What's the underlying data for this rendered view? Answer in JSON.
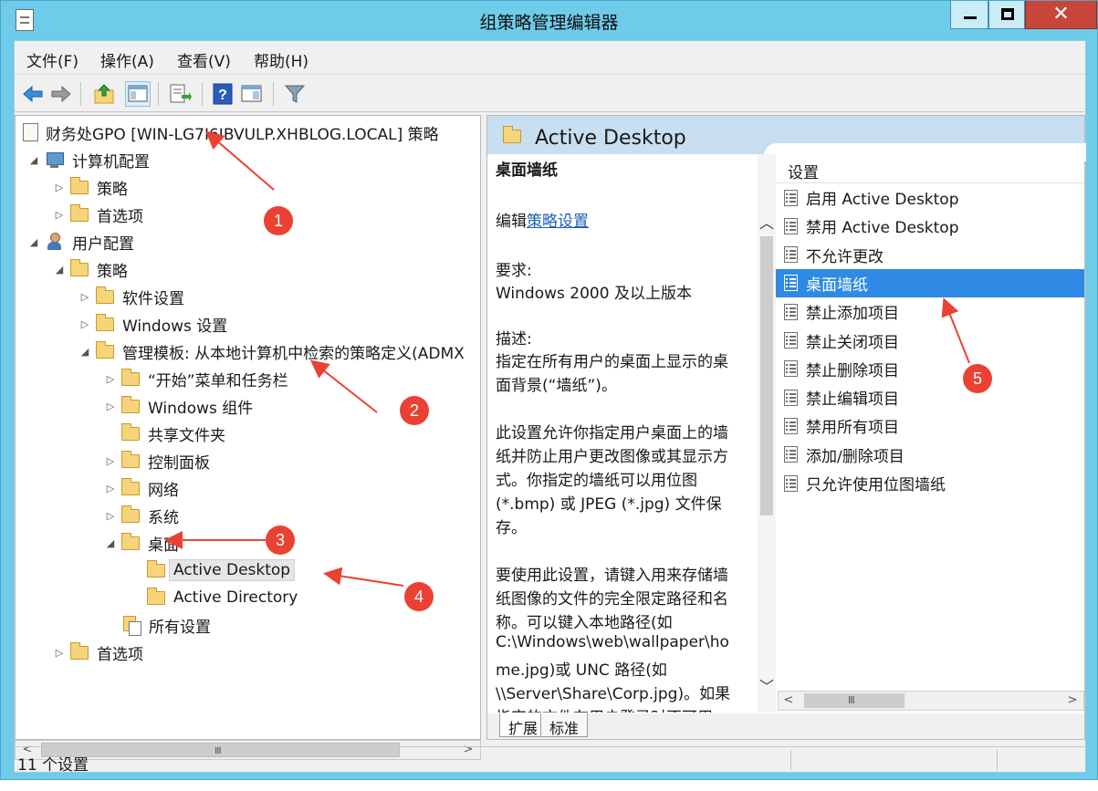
{
  "window": {
    "title": "组策略管理编辑器",
    "close_glyph": "✕"
  },
  "menu": {
    "file": "文件(F)",
    "action": "操作(A)",
    "view": "查看(V)",
    "help": "帮助(H)"
  },
  "toolbar": {
    "icons": [
      "back-arrow-icon",
      "forward-arrow-icon",
      "up-folder-icon",
      "show-hide-tree-icon",
      "export-list-icon",
      "help-icon",
      "show-hide-action-pane-icon",
      "filter-icon"
    ]
  },
  "tree": {
    "root": "财务处GPO [WIN-LG7I6IBVULP.XHBLOG.LOCAL] 策略",
    "computer_config": "计算机配置",
    "cc_policies": "策略",
    "cc_preferences": "首选项",
    "user_config": "用户配置",
    "uc_policies": "策略",
    "software_settings": "软件设置",
    "windows_settings": "Windows 设置",
    "admin_templates": "管理模板: 从本地计算机中检索的策略定义(ADMX",
    "start_menu": "“开始”菜单和任务栏",
    "windows_components": "Windows 组件",
    "shared_folders": "共享文件夹",
    "control_panel": "控制面板",
    "network": "网络",
    "system": "系统",
    "desktop": "桌面",
    "active_desktop": "Active Desktop",
    "active_directory": "Active Directory",
    "all_settings": "所有设置",
    "uc_preferences": "首选项"
  },
  "scrollbar": {
    "left": "<",
    "right": ">",
    "up": "︿",
    "down": "﹀",
    "grip": "III"
  },
  "right": {
    "header_title": "Active Desktop",
    "desc": {
      "title": "桌面墙纸",
      "edit_prefix": "编辑",
      "edit_link": "策略设置",
      "requirement_label": "要求:",
      "requirement_value": "Windows 2000 及以上版本",
      "description_label": "描述:",
      "lines": [
        "指定在所有用户的桌面上显示的桌",
        "面背景(“墙纸”)。",
        "",
        "此设置允许你指定用户桌面上的墙",
        "纸并防止用户更改图像或其显示方",
        "式。你指定的墙纸可以用位图",
        "(*.bmp) 或 JPEG (*.jpg) 文件保",
        "存。",
        "",
        "要使用此设置，请键入用来存储墙",
        "纸图像的文件的完全限定路径和名",
        "称。可以键入本地路径(如",
        "C:\\Windows\\web\\wallpaper\\ho",
        "me.jpg)或 UNC 路径(如",
        "\\\\Server\\Share\\Corp.jpg)。如果",
        "指定的文件在用户登录时不可用"
      ]
    },
    "settings_header": "设置",
    "settings": [
      "启用 Active Desktop",
      "禁用 Active Desktop",
      "不允许更改",
      "桌面墙纸",
      "禁止添加项目",
      "禁止关闭项目",
      "禁止删除项目",
      "禁止编辑项目",
      "禁用所有项目",
      "添加/删除项目",
      "只允许使用位图墙纸"
    ],
    "selected_setting": "桌面墙纸",
    "tabs": {
      "extended": "扩展",
      "standard": "标准"
    }
  },
  "status": {
    "text": "11 个设置"
  },
  "annotations": {
    "labels": [
      "1",
      "2",
      "3",
      "4",
      "5"
    ],
    "color": "#ea4133"
  },
  "colors": {
    "titlebar": "#6ecbea",
    "selection": "#2f8ae5",
    "link": "#1d5fb8",
    "header": "#c7dff0"
  }
}
